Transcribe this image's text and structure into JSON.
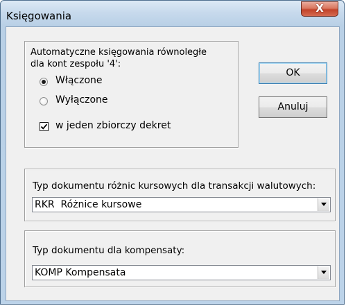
{
  "window": {
    "title": "Księgowania",
    "close_label": "X"
  },
  "auto_posting": {
    "description_line1": "Automatyczne księgowania równoległe",
    "description_line2": "dla kont zespołu '4':",
    "options": [
      {
        "label": "Włączone",
        "selected": true
      },
      {
        "label": "Wyłączone",
        "selected": false
      }
    ],
    "single_decree": {
      "label": "w jeden zbiorczy dekret",
      "checked": true
    }
  },
  "buttons": {
    "ok": "OK",
    "cancel": "Anuluj"
  },
  "exchange_doc": {
    "label": "Typ dokumentu różnic kursowych dla transakcji walutowych:",
    "selected": "RKR  Różnice kursowe"
  },
  "compensation_doc": {
    "label": "Typ dokumentu dla kompensaty:",
    "selected": "KOMP Kompensata"
  },
  "icons": {
    "close": "close-icon",
    "dropdown": "chevron-down-icon",
    "check": "check-icon"
  }
}
